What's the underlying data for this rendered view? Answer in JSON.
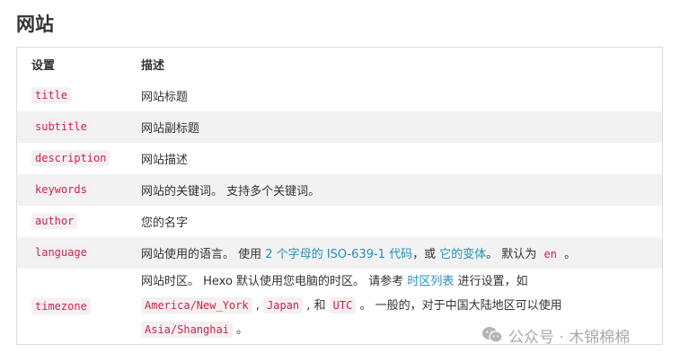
{
  "page": {
    "title": "网站"
  },
  "table": {
    "headers": {
      "setting": "设置",
      "description": "描述"
    },
    "rows": [
      {
        "setting": "title",
        "description": "网站标题"
      },
      {
        "setting": "subtitle",
        "description": "网站副标题"
      },
      {
        "setting": "description",
        "description": "网站描述"
      },
      {
        "setting": "keywords",
        "description": "网站的关键词。 支持多个关键词。"
      },
      {
        "setting": "author",
        "description": "您的名字"
      }
    ],
    "language_row": {
      "setting": "language",
      "text_1": "网站使用的语言。 使用 ",
      "link_1": "2 个字母的 ISO-639-1 代码",
      "text_2": "，或 ",
      "link_2": "它的变体",
      "text_3": "。 默认为 ",
      "code_default": "en",
      "text_4": " 。"
    },
    "timezone_row": {
      "setting": "timezone",
      "text_1": "网站时区。 Hexo 默认使用您电脑的时区。 请参考 ",
      "link_1": "时区列表",
      "text_2": " 进行设置，如",
      "code_1": "America/New_York",
      "sep_1": " , ",
      "code_2": "Japan",
      "sep_2": " , 和 ",
      "code_3": "UTC",
      "text_3": " 。 一般的，对于中国大陆地区可以使用",
      "code_4": "Asia/Shanghai",
      "text_4": " 。"
    }
  },
  "watermark": {
    "text": "公众号 · 木锦棉棉",
    "icon": "wechat-icon"
  },
  "colors": {
    "code_text": "#c7254e",
    "link": "#258fb8",
    "row_alt_bg": "#f2f2f2"
  }
}
